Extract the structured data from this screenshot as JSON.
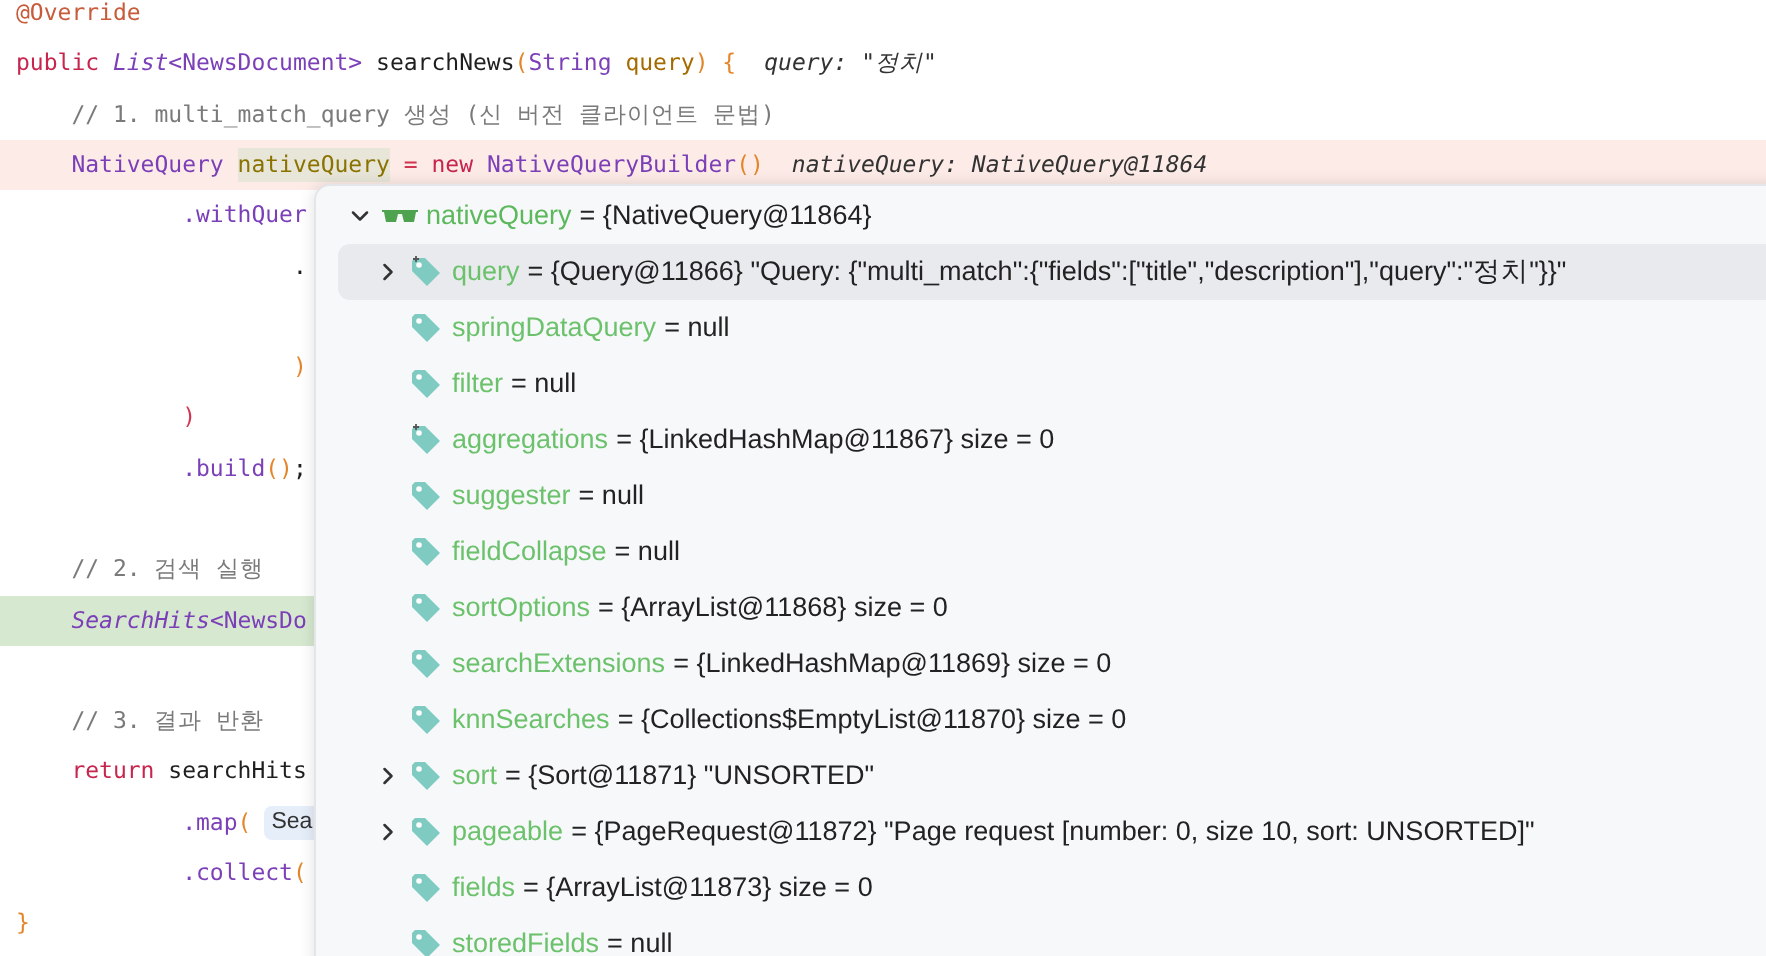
{
  "code_lines": [
    {
      "kind": "normal",
      "tokens": [
        {
          "text": "@Override",
          "kind": "annotation"
        }
      ]
    },
    {
      "kind": "normal",
      "tokens": [
        {
          "text": "public ",
          "kind": "keyword"
        },
        {
          "text": "List",
          "kind": "type_italic"
        },
        {
          "text": "<NewsDocument>",
          "kind": "type"
        },
        {
          "text": " searchNews",
          "kind": "plain"
        },
        {
          "text": "(",
          "kind": "paren"
        },
        {
          "text": "String",
          "kind": "type"
        },
        {
          "text": " query",
          "kind": "param"
        },
        {
          "text": ")",
          "kind": "paren"
        },
        {
          "text": " {",
          "kind": "paren"
        },
        {
          "text": "query: \"정치\"",
          "kind": "hint"
        }
      ]
    },
    {
      "kind": "normal",
      "tokens": [
        {
          "text": "    // 1. multi_match_query 생성 (신 버전 클라이언트 문법)",
          "kind": "comment"
        }
      ]
    },
    {
      "kind": "breakpoint",
      "tokens": [
        {
          "text": "    NativeQuery ",
          "kind": "type"
        },
        {
          "text": "nativeQuery",
          "kind": "variable"
        },
        {
          "text": " = ",
          "kind": "operator"
        },
        {
          "text": "new ",
          "kind": "keyword"
        },
        {
          "text": "NativeQueryBuilder",
          "kind": "type"
        },
        {
          "text": "()",
          "kind": "paren"
        },
        {
          "text": "nativeQuery: NativeQuery@11864",
          "kind": "hint"
        }
      ]
    },
    {
      "kind": "normal",
      "tokens": [
        {
          "text": "            .withQuer",
          "kind": "method"
        }
      ]
    },
    {
      "kind": "normal",
      "tokens": [
        {
          "text": "                    .",
          "kind": "plain"
        }
      ]
    },
    {
      "kind": "normal"
    },
    {
      "kind": "normal",
      "tokens": [
        {
          "text": "                    )",
          "kind": "paren"
        }
      ]
    },
    {
      "kind": "normal",
      "tokens": [
        {
          "text": "            )",
          "kind": "operator"
        }
      ]
    },
    {
      "kind": "normal",
      "tokens": [
        {
          "text": "            .build",
          "kind": "method"
        },
        {
          "text": "()",
          "kind": "paren"
        },
        {
          "text": ";",
          "kind": "plain"
        }
      ]
    },
    {
      "kind": "normal"
    },
    {
      "kind": "normal",
      "tokens": [
        {
          "text": "    // 2. 검색 실행",
          "kind": "comment"
        }
      ]
    },
    {
      "kind": "execution",
      "tokens": [
        {
          "text": "    SearchHits",
          "kind": "type_italic"
        },
        {
          "text": "<NewsDo",
          "kind": "type"
        }
      ]
    },
    {
      "kind": "normal"
    },
    {
      "kind": "normal",
      "tokens": [
        {
          "text": "    // 3. 결과 반환",
          "kind": "comment"
        }
      ]
    },
    {
      "kind": "normal",
      "tokens": [
        {
          "text": "    return",
          "kind": "keyword"
        },
        {
          "text": " searchHits",
          "kind": "plain"
        }
      ]
    },
    {
      "kind": "normal",
      "tokens": [
        {
          "text": "            .map",
          "kind": "method"
        },
        {
          "text": "(",
          "kind": "paren"
        },
        {
          "text": "Sea",
          "kind": "chip"
        }
      ]
    },
    {
      "kind": "normal",
      "tokens": [
        {
          "text": "            .collect",
          "kind": "method"
        },
        {
          "text": "(",
          "kind": "paren"
        }
      ]
    },
    {
      "kind": "normal",
      "tokens": [
        {
          "text": "}",
          "kind": "paren"
        }
      ]
    }
  ],
  "debugger_popup": {
    "root": {
      "name": "nativeQuery",
      "value": "= {NativeQuery@11864}",
      "expanded": true,
      "children": [
        {
          "name": "query",
          "value": "= {Query@11866} \"Query: {\"multi_match\":{\"fields\":[\"title\",\"description\"],\"query\":\"정치\"}}\"",
          "kind": "static_field",
          "expandable": true,
          "selected": true
        },
        {
          "name": "springDataQuery",
          "value": "= null",
          "kind": "field",
          "expandable": false,
          "selected": false
        },
        {
          "name": "filter",
          "value": "= null",
          "kind": "field",
          "expandable": false,
          "selected": false
        },
        {
          "name": "aggregations",
          "value": "= {LinkedHashMap@11867}  size = 0",
          "kind": "static_field",
          "expandable": false,
          "selected": false
        },
        {
          "name": "suggester",
          "value": "= null",
          "kind": "field",
          "expandable": false,
          "selected": false
        },
        {
          "name": "fieldCollapse",
          "value": "= null",
          "kind": "field",
          "expandable": false,
          "selected": false
        },
        {
          "name": "sortOptions",
          "value": "= {ArrayList@11868}  size = 0",
          "kind": "field",
          "expandable": false,
          "selected": false
        },
        {
          "name": "searchExtensions",
          "value": "= {LinkedHashMap@11869}  size = 0",
          "kind": "field",
          "expandable": false,
          "selected": false
        },
        {
          "name": "knnSearches",
          "value": "= {Collections$EmptyList@11870}  size = 0",
          "kind": "field",
          "expandable": false,
          "selected": false
        },
        {
          "name": "sort",
          "value": "= {Sort@11871} \"UNSORTED\"",
          "kind": "field",
          "expandable": true,
          "selected": false
        },
        {
          "name": "pageable",
          "value": "= {PageRequest@11872} \"Page request [number: 0, size 10, sort: UNSORTED]\"",
          "kind": "field",
          "expandable": true,
          "selected": false
        },
        {
          "name": "fields",
          "value": "= {ArrayList@11873}  size = 0",
          "kind": "field",
          "expandable": false,
          "selected": false
        },
        {
          "name": "storedFields",
          "value": "= null",
          "kind": "field",
          "expandable": false,
          "selected": false
        }
      ]
    }
  }
}
